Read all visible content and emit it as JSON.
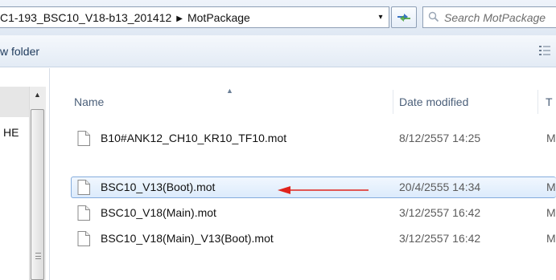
{
  "address_bar": {
    "path_segment": "C1-193_BSC10_V18-b13_201412",
    "separator": "▶",
    "current_folder": "MotPackage",
    "dropdown_glyph": "▾"
  },
  "search": {
    "placeholder": "Search MotPackage"
  },
  "toolbar": {
    "new_folder_label": "w folder"
  },
  "nav_pane": {
    "partial_item_text": "HE"
  },
  "columns": {
    "name": "Name",
    "date_modified": "Date modified",
    "type": "T"
  },
  "files": [
    {
      "name": "B10#ANK12_CH10_KR10_TF10.mot",
      "date": "8/12/2557 14:25",
      "type": "M",
      "selected": false
    },
    {
      "name": "BSC10_V13(Boot).mot",
      "date": "20/4/2555 14:34",
      "type": "M",
      "selected": true
    },
    {
      "name": "BSC10_V18(Main).mot",
      "date": "3/12/2557 16:42",
      "type": "M",
      "selected": false
    },
    {
      "name": "BSC10_V18(Main)_V13(Boot).mot",
      "date": "3/12/2557 16:42",
      "type": "M",
      "selected": false
    }
  ],
  "annotation": {
    "arrow_color": "#e0231c"
  },
  "icons": {
    "refresh": "refresh-icon",
    "search": "search-icon",
    "views": "views-icon",
    "file": "file-icon"
  }
}
